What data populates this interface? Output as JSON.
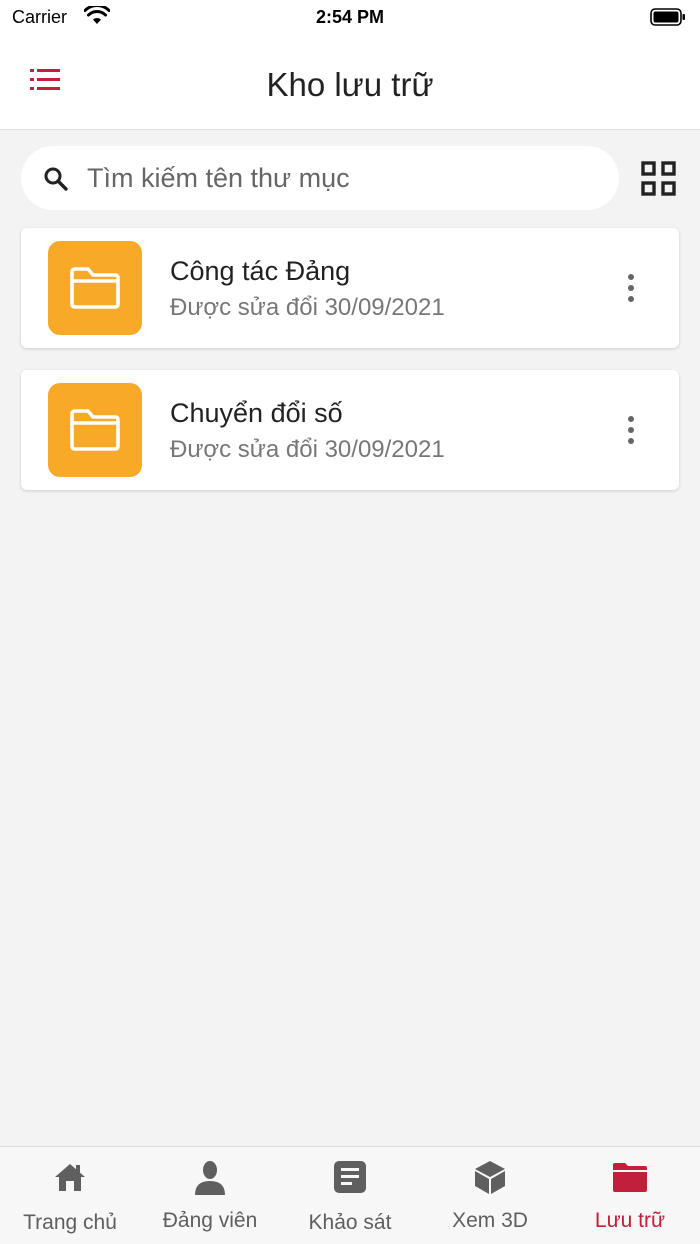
{
  "status_bar": {
    "carrier": "Carrier",
    "time": "2:54 PM"
  },
  "header": {
    "title": "Kho lưu trữ",
    "menu_icon": "menu-list-icon",
    "accent_color": "#c21f3a"
  },
  "search": {
    "placeholder": "Tìm kiếm tên thư mục",
    "value": ""
  },
  "view_toggle_icon": "grid-view-icon",
  "folders": [
    {
      "name": "Công tác Đảng",
      "modified": "Được sửa đổi 30/09/2021",
      "icon": "folder-icon"
    },
    {
      "name": "Chuyển đổi số",
      "modified": "Được sửa đổi 30/09/2021",
      "icon": "folder-icon"
    }
  ],
  "folder_color": "#f8a928",
  "bottom_nav": {
    "items": [
      {
        "label": "Trang chủ",
        "icon": "home-icon",
        "active": false
      },
      {
        "label": "Đảng viên",
        "icon": "person-icon",
        "active": false
      },
      {
        "label": "Khảo sát",
        "icon": "survey-icon",
        "active": false
      },
      {
        "label": "Xem 3D",
        "icon": "cube-icon",
        "active": false
      },
      {
        "label": "Lưu trữ",
        "icon": "folder-icon",
        "active": true
      }
    ],
    "active_color": "#c21f3a",
    "inactive_color": "#5f5f5f"
  }
}
